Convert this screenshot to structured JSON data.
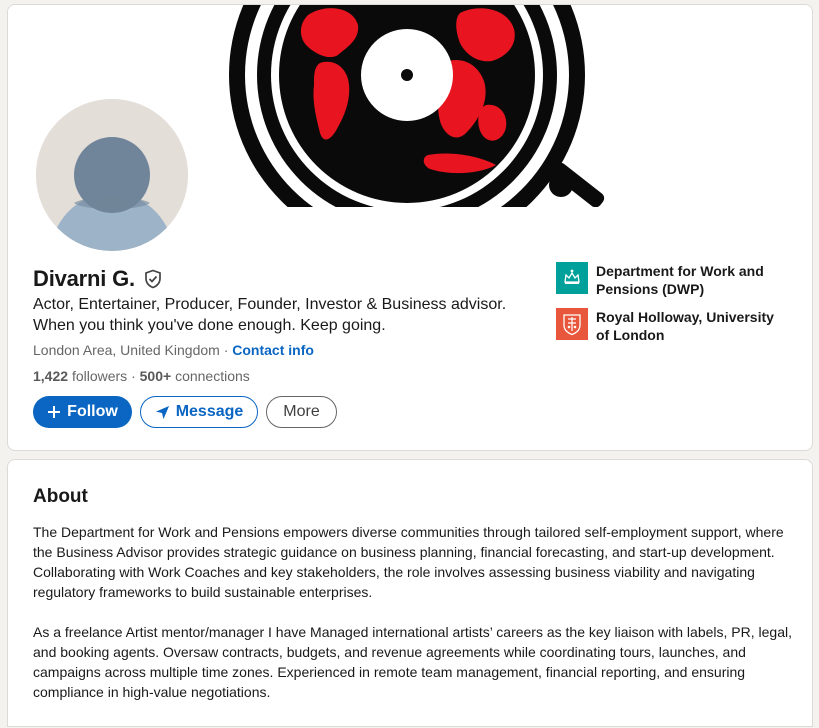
{
  "profile": {
    "name": "Divarni G.",
    "headline_line1": "Actor, Entertainer, Producer, Founder, Investor & Business advisor.",
    "headline_line2": "When you think you've done enough. Keep going.",
    "location": "London Area, United Kingdom",
    "separator": "·",
    "contact_label": "Contact info",
    "followers_count": "1,422",
    "followers_label": "followers",
    "connections_sep": "·",
    "connections_count": "500+",
    "connections_label": "connections",
    "icons": {
      "verified": "shield-check-icon",
      "avatar": "default-person-icon"
    }
  },
  "actions": {
    "follow_label": "Follow",
    "message_label": "Message",
    "more_label": "More"
  },
  "organizations": [
    {
      "name": "Department for Work and Pensions (DWP)",
      "logo_color": "#00a19a"
    },
    {
      "name": "Royal Holloway, University of London",
      "logo_color": "#e8563b"
    }
  ],
  "about": {
    "title": "About",
    "paragraph1": "The Department for Work and Pensions empowers diverse communities through tailored self-employment support, where the Business Advisor provides strategic guidance on business planning, financial forecasting, and start-up development. Collaborating with Work Coaches and key stakeholders, the role involves assessing business viability and navigating regulatory frameworks to build sustainable enterprises.",
    "paragraph2": "As a freelance Artist mentor/manager I have Managed international artists’ careers as the key liaison with labels, PR, legal, and booking agents. Oversaw contracts, budgets, and revenue agreements while coordinating tours, launches, and campaigns across multiple time zones. Experienced in remote team management, financial reporting, and ensuring compliance in high-value negotiations."
  },
  "colors": {
    "accent": "#0a66c2",
    "banner_red": "#e8141f",
    "banner_black": "#0a0a0a"
  }
}
